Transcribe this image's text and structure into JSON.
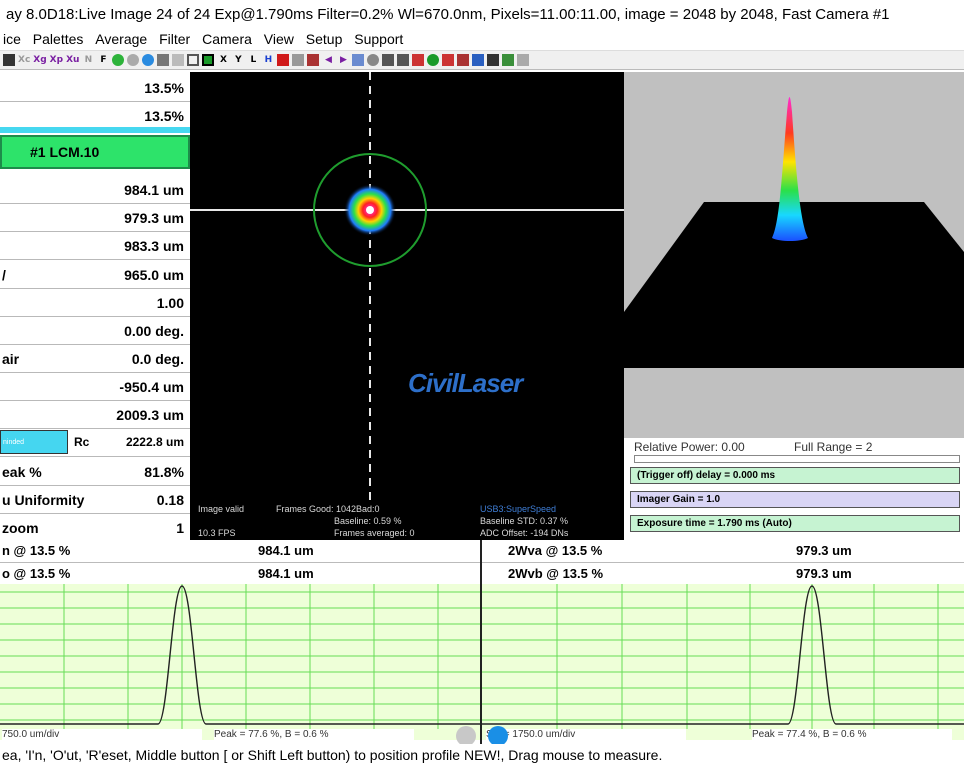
{
  "title": "ay 8.0D18:Live Image 24 of 24     Exp@1.790ms Filter=0.2%     Wl=670.0nm, Pixels=11.00:11.00, image = 2048 by 2048, Fast   Camera #1",
  "menu": [
    "ice",
    "Palettes",
    "Average",
    "Filter",
    "Camera",
    "View",
    "Setup",
    "Support"
  ],
  "toolbar": [
    "Xc",
    "Xg",
    "Xp",
    "Xu",
    "N",
    "F",
    "X",
    "Y",
    "L",
    "H"
  ],
  "params": {
    "r1": {
      "label": "",
      "value": "13.5%"
    },
    "r2": {
      "label": "",
      "value": "13.5%"
    },
    "r3": {
      "label": "#1 LCM.10",
      "value": ""
    },
    "r4": {
      "label": "",
      "value": "984.1 um"
    },
    "r5": {
      "label": "",
      "value": "979.3 um"
    },
    "r6": {
      "label": "",
      "value": "983.3 um"
    },
    "r7": {
      "label": "/",
      "value": "965.0 um"
    },
    "r8": {
      "label": "",
      "value": "1.00"
    },
    "r9": {
      "label": "",
      "value": "0.00 deg."
    },
    "r10": {
      "label": "air",
      "value": "0.0 deg."
    },
    "r11": {
      "label": "",
      "value": "-950.4 um"
    },
    "r12": {
      "label": "",
      "value": "2009.3 um"
    },
    "rc": {
      "box": "ninded",
      "label": "Rc",
      "value": "2222.8 um"
    },
    "r14": {
      "label": "eak %",
      "value": "81.8%"
    },
    "r15": {
      "label": "u Uniformity",
      "value": "0.18"
    },
    "r16": {
      "label": "zoom",
      "value": "1"
    }
  },
  "beam": {
    "logo": "CivilLaser",
    "stats": {
      "valid": "Image valid",
      "fps": "10.3 FPS",
      "frames_good": "Frames Good: 1042Bad:0",
      "baseline": "Baseline: 0.59 %",
      "frames_avg": "Frames averaged: 0",
      "usb": "USB3:SuperSpeed",
      "baseline_std": "Baseline STD:  0.37 %",
      "adc": "ADC Offset:  -194 DNs"
    }
  },
  "controls": {
    "relative_power": "Relative Power: 0.00",
    "full_range": "Full Range = 2",
    "relative_power_level": 0.0,
    "trigger": "(Trigger off) delay = 0.000 ms",
    "gain": "Imager Gain = 1.0",
    "exposure": "Exposure time = 1.790 ms (Auto)"
  },
  "widths": {
    "left": [
      {
        "label": "n @ 13.5 %",
        "value": "984.1 um"
      },
      {
        "label": "o @ 13.5 %",
        "value": "984.1 um"
      }
    ],
    "right": [
      {
        "label": "2Wva @ 13.5 %",
        "value": "979.3 um"
      },
      {
        "label": "2Wvb @ 13.5 %",
        "value": "979.3 um"
      }
    ]
  },
  "profiles": {
    "left_footer": "750.0 um/div",
    "left_peak": "Peak = 77.6 %,  B = 0.6 %",
    "right_footer_left": "S   e = 1750.0 um/div",
    "right_peak": "Peak = 77.4 %,  B = 0.6 %"
  },
  "status": "ea, 'I'n, 'O'ut, 'R'eset, Middle button [ or Shift Left button) to position profile NEW!, Drag mouse to measure.",
  "colors": {
    "accent_green": "#2de36a",
    "profile_bg": "#eeffd8",
    "grid": "#66dd55"
  }
}
